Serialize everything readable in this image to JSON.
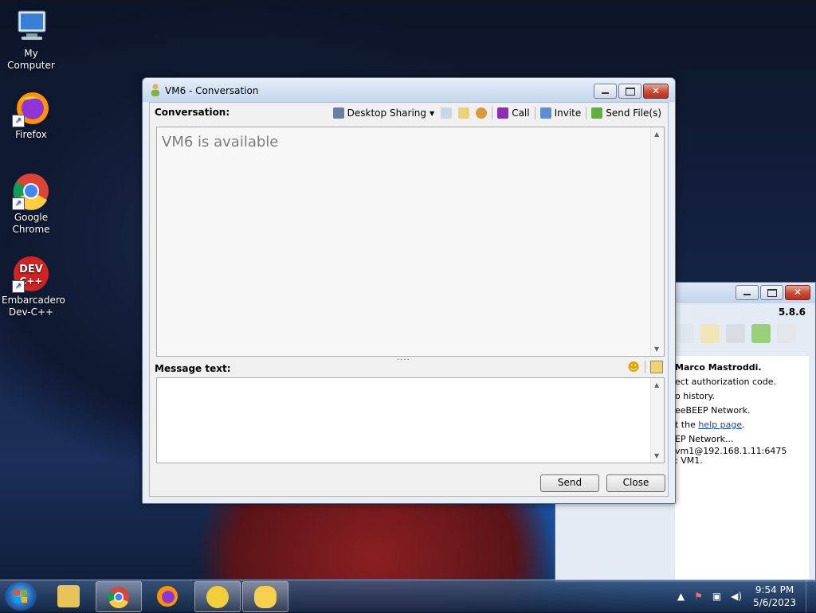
{
  "desktop": {
    "icons": [
      {
        "label": "My Computer",
        "icon": "computer-icon"
      },
      {
        "label": "Firefox",
        "icon": "firefox-icon"
      },
      {
        "label": "Google Chrome",
        "icon": "chrome-icon"
      },
      {
        "label": "Embarcadero Dev-C++",
        "icon": "devcpp-icon"
      }
    ]
  },
  "conversation_window": {
    "title": "VM6 - Conversation",
    "conversation_label": "Conversation:",
    "toolbar": {
      "desktop_sharing": "Desktop Sharing",
      "call": "Call",
      "invite": "Invite",
      "send_files": "Send File(s)"
    },
    "chat_status": "VM6 is available",
    "message_label": "Message text:",
    "message_value": "",
    "send_label": "Send",
    "close_label": "Close"
  },
  "background_window": {
    "version": "5.8.6",
    "log": [
      "Marco Mastroddi.",
      "ect authorization code.",
      "o history.",
      "eeBEEP Network.",
      "t the ",
      "EP Network...",
      "vm1@192.168.1.11:6475",
      ": VM1."
    ],
    "help_link": "help page",
    "help_suffix": "."
  },
  "taskbar": {
    "time": "9:54 PM",
    "date": "5/6/2023"
  },
  "colors": {
    "titlebar": "#d5e2f2",
    "close_button": "#c64a35",
    "link": "#1a3fbf"
  }
}
